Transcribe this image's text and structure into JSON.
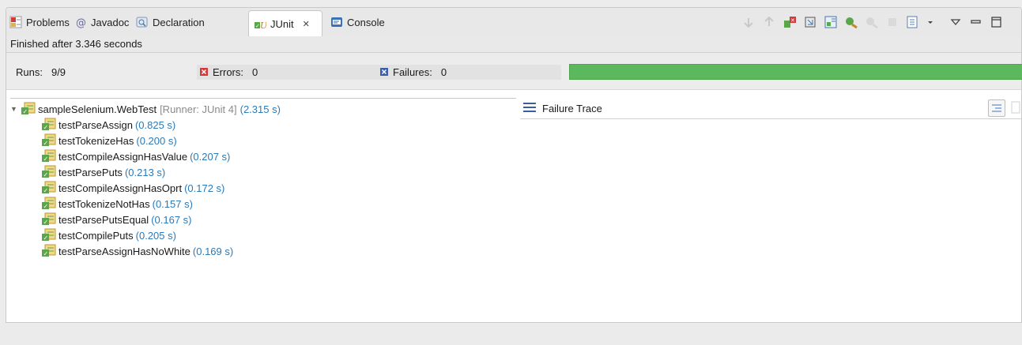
{
  "tabs": [
    {
      "label": "Problems",
      "icon": "problems-icon"
    },
    {
      "label": "Javadoc",
      "icon": "javadoc-icon"
    },
    {
      "label": "Declaration",
      "icon": "declaration-icon"
    },
    {
      "label": "JUnit",
      "icon": "junit-icon",
      "close": "✕",
      "active": true
    },
    {
      "label": "Console",
      "icon": "console-icon"
    }
  ],
  "status": "Finished after 3.346 seconds",
  "counters": {
    "runs_label": "Runs:",
    "runs_value": "9/9",
    "errors_label": "Errors:",
    "errors_value": "0",
    "failures_label": "Failures:",
    "failures_value": "0",
    "progress_fraction": 1.0,
    "progress_color": "#5cb85c"
  },
  "tree": {
    "root_name": "sampleSelenium.WebTest",
    "root_runner": "[Runner: JUnit 4]",
    "root_time": "(2.315 s)",
    "tests": [
      {
        "name": "testParseAssign",
        "time": "(0.825 s)"
      },
      {
        "name": "testTokenizeHas",
        "time": "(0.200 s)"
      },
      {
        "name": "testCompileAssignHasValue",
        "time": "(0.207 s)"
      },
      {
        "name": "testParsePuts",
        "time": "(0.213 s)"
      },
      {
        "name": "testCompileAssignHasOprt",
        "time": "(0.172 s)"
      },
      {
        "name": "testTokenizeNotHas",
        "time": "(0.157 s)"
      },
      {
        "name": "testParsePutsEqual",
        "time": "(0.167 s)"
      },
      {
        "name": "testCompilePuts",
        "time": "(0.205 s)"
      },
      {
        "name": "testParseAssignHasNoWhite",
        "time": "(0.169 s)"
      }
    ]
  },
  "trace": {
    "label": "Failure Trace"
  },
  "colors": {
    "time": "#2a7ab8",
    "success": "#5cb85c"
  }
}
